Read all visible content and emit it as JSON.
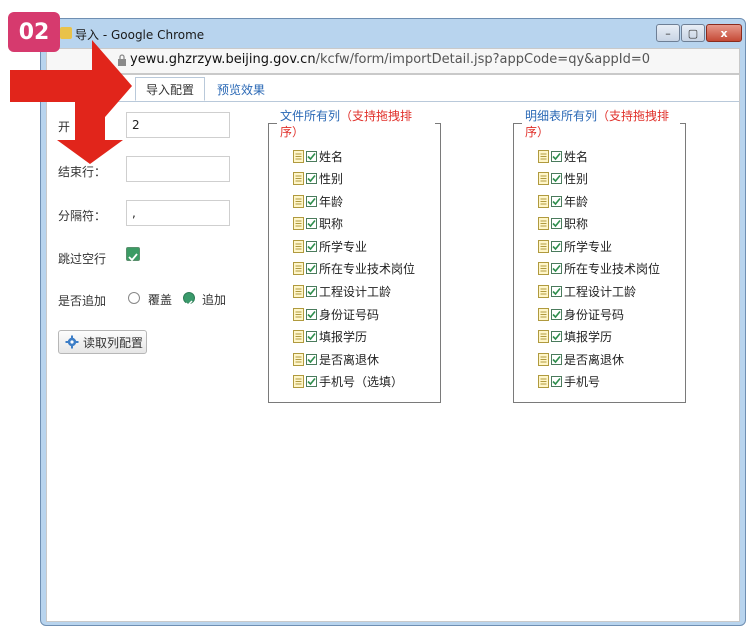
{
  "badge": {
    "label": "02"
  },
  "window": {
    "title": "导入 - Google Chrome",
    "minimize_label": "–",
    "maximize_label": "▢",
    "close_label": "x"
  },
  "address": {
    "host": "yewu.ghzrzyw.beijing.gov.cn",
    "path": "/kcfw/form/importDetail.jsp?appCode=qy&appId=0"
  },
  "tabs": [
    {
      "label": "导入配置",
      "active": true
    },
    {
      "label": "预览效果",
      "active": false
    }
  ],
  "form": {
    "start_row_label": "开",
    "start_row_value": "2",
    "end_row_label": "结束行：",
    "end_row_value": "",
    "separator_label": "分隔符：",
    "separator_value": ",",
    "skip_empty_label": "跳过空行",
    "skip_empty_checked": true,
    "append_label": "是否追加",
    "option_overwrite": "覆盖",
    "option_append": "追加",
    "append_selected": "追加",
    "read_columns_button": "读取列配置"
  },
  "file_columns": {
    "legend_prefix": "文件所有列",
    "legend_red_line1": "（支持拖拽排",
    "legend_red_line2": "序）",
    "items": [
      "姓名",
      "性别",
      "年龄",
      "职称",
      "所学专业",
      "所在专业技术岗位",
      "工程设计工龄",
      "身份证号码",
      "填报学历",
      "是否离退休",
      "手机号（选填）"
    ]
  },
  "detail_columns": {
    "legend_prefix": "明细表所有列",
    "legend_red_line1": "（支持拖拽排",
    "legend_red_line2": "序）",
    "items": [
      "姓名",
      "性别",
      "年龄",
      "职称",
      "所学专业",
      "所在专业技术岗位",
      "工程设计工龄",
      "身份证号码",
      "填报学历",
      "是否离退休",
      "手机号"
    ]
  },
  "icons": {
    "arrow": "red-arrow-annotation",
    "lock": "lock-icon",
    "gear": "gear-icon",
    "doc": "document-icon"
  },
  "colors": {
    "badge": "#d63a6e",
    "arrow": "#e1251b",
    "tab_link": "#2a68b5",
    "legend_red": "#e0302a",
    "check_green": "#3b9b64"
  }
}
